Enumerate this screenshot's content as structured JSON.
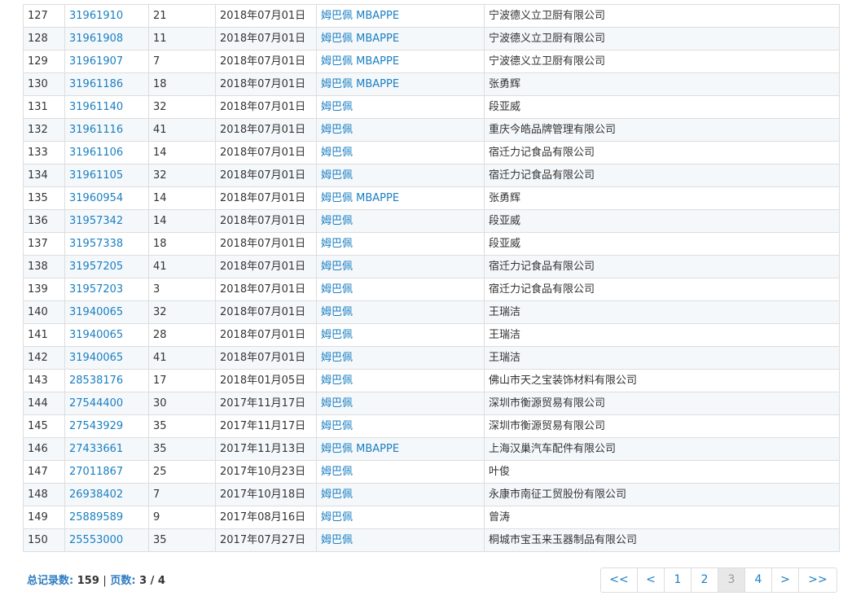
{
  "rows": [
    {
      "no": "127",
      "reg": "31961910",
      "cls": "21",
      "date": "2018年07月01日",
      "mark": "姆巴佩 MBAPPE",
      "applicant": "宁波德义立卫厨有限公司"
    },
    {
      "no": "128",
      "reg": "31961908",
      "cls": "11",
      "date": "2018年07月01日",
      "mark": "姆巴佩 MBAPPE",
      "applicant": "宁波德义立卫厨有限公司"
    },
    {
      "no": "129",
      "reg": "31961907",
      "cls": "7",
      "date": "2018年07月01日",
      "mark": "姆巴佩 MBAPPE",
      "applicant": "宁波德义立卫厨有限公司"
    },
    {
      "no": "130",
      "reg": "31961186",
      "cls": "18",
      "date": "2018年07月01日",
      "mark": "姆巴佩 MBAPPE",
      "applicant": "张勇辉"
    },
    {
      "no": "131",
      "reg": "31961140",
      "cls": "32",
      "date": "2018年07月01日",
      "mark": "姆巴佩",
      "applicant": "段亚威"
    },
    {
      "no": "132",
      "reg": "31961116",
      "cls": "41",
      "date": "2018年07月01日",
      "mark": "姆巴佩",
      "applicant": "重庆今皓品牌管理有限公司"
    },
    {
      "no": "133",
      "reg": "31961106",
      "cls": "14",
      "date": "2018年07月01日",
      "mark": "姆巴佩",
      "applicant": "宿迁力记食品有限公司"
    },
    {
      "no": "134",
      "reg": "31961105",
      "cls": "32",
      "date": "2018年07月01日",
      "mark": "姆巴佩",
      "applicant": "宿迁力记食品有限公司"
    },
    {
      "no": "135",
      "reg": "31960954",
      "cls": "14",
      "date": "2018年07月01日",
      "mark": "姆巴佩 MBAPPE",
      "applicant": "张勇辉"
    },
    {
      "no": "136",
      "reg": "31957342",
      "cls": "14",
      "date": "2018年07月01日",
      "mark": "姆巴佩",
      "applicant": "段亚威"
    },
    {
      "no": "137",
      "reg": "31957338",
      "cls": "18",
      "date": "2018年07月01日",
      "mark": "姆巴佩",
      "applicant": "段亚威"
    },
    {
      "no": "138",
      "reg": "31957205",
      "cls": "41",
      "date": "2018年07月01日",
      "mark": "姆巴佩",
      "applicant": "宿迁力记食品有限公司"
    },
    {
      "no": "139",
      "reg": "31957203",
      "cls": "3",
      "date": "2018年07月01日",
      "mark": "姆巴佩",
      "applicant": "宿迁力记食品有限公司"
    },
    {
      "no": "140",
      "reg": "31940065",
      "cls": "32",
      "date": "2018年07月01日",
      "mark": "姆巴佩",
      "applicant": "王瑞洁"
    },
    {
      "no": "141",
      "reg": "31940065",
      "cls": "28",
      "date": "2018年07月01日",
      "mark": "姆巴佩",
      "applicant": "王瑞洁"
    },
    {
      "no": "142",
      "reg": "31940065",
      "cls": "41",
      "date": "2018年07月01日",
      "mark": "姆巴佩",
      "applicant": "王瑞洁"
    },
    {
      "no": "143",
      "reg": "28538176",
      "cls": "17",
      "date": "2018年01月05日",
      "mark": "姆巴佩",
      "applicant": "佛山市天之宝装饰材料有限公司"
    },
    {
      "no": "144",
      "reg": "27544400",
      "cls": "30",
      "date": "2017年11月17日",
      "mark": "姆巴佩",
      "applicant": "深圳市衡源贸易有限公司"
    },
    {
      "no": "145",
      "reg": "27543929",
      "cls": "35",
      "date": "2017年11月17日",
      "mark": "姆巴佩",
      "applicant": "深圳市衡源贸易有限公司"
    },
    {
      "no": "146",
      "reg": "27433661",
      "cls": "35",
      "date": "2017年11月13日",
      "mark": "姆巴佩 MBAPPE",
      "applicant": "上海汉巢汽车配件有限公司"
    },
    {
      "no": "147",
      "reg": "27011867",
      "cls": "25",
      "date": "2017年10月23日",
      "mark": "姆巴佩",
      "applicant": "叶俊"
    },
    {
      "no": "148",
      "reg": "26938402",
      "cls": "7",
      "date": "2017年10月18日",
      "mark": "姆巴佩",
      "applicant": "永康市南征工贸股份有限公司"
    },
    {
      "no": "149",
      "reg": "25889589",
      "cls": "9",
      "date": "2017年08月16日",
      "mark": "姆巴佩",
      "applicant": "曾涛"
    },
    {
      "no": "150",
      "reg": "25553000",
      "cls": "35",
      "date": "2017年07月27日",
      "mark": "姆巴佩",
      "applicant": "桐城市宝玉来玉器制品有限公司"
    }
  ],
  "footer": {
    "total_label": "总记录数:",
    "total_value": "159",
    "separator": "|",
    "pages_label": "页数:",
    "pages_value": "3 / 4"
  },
  "pagination": {
    "first": "<<",
    "prev": "<",
    "pages": [
      "1",
      "2",
      "3",
      "4"
    ],
    "next": ">",
    "last": ">>",
    "current": "3"
  }
}
